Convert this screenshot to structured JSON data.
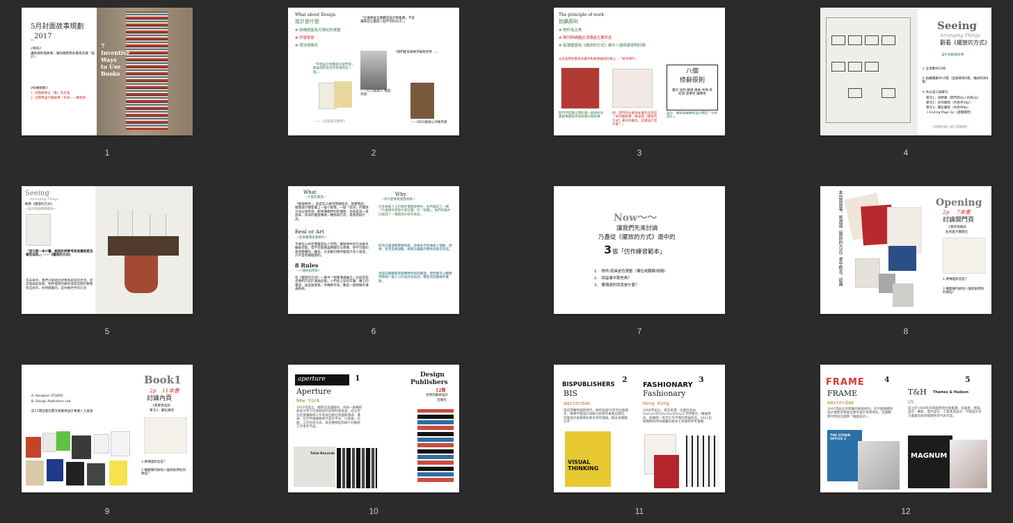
{
  "slides": [
    {
      "number": "1",
      "title": "5月封面故事規劃",
      "subtitle": "_2017",
      "goal_head": "//目的//",
      "goal": "讓組員對面故事，讓你願資預多書來認識「設計」",
      "idea_head": "//好構挑繁//",
      "idea1": "1. 封面故事以「書」為主角",
      "idea2": "2. 主題用設計面故事「形式」一觀相承",
      "cover_text": "7 Inventive Ways to Use Books"
    },
    {
      "number": "2",
      "heading": "What about Design",
      "title": "設計是什麼",
      "tag1": "# 將構想變為可視化的現實",
      "tag2": "# 符號學家",
      "tag3": "# 想法視覺化",
      "para1": "「企業將會全面體成設計師集團，不是讓來認之變成一個平均的日子。」",
      "para2": "「我們經常被要求擁有更早的溝通的方式，以當」",
      "quote1": "「平面設計師都是符號學家，無論他們是否有意識到這一點。」",
      "quote2": "「我們經常被要求擁抱世界…」",
      "cap1": "——《這就是符號學》",
      "cap2": "——CCC創辦人 增田宗昭",
      "cap3": "——IDEO創辦公司擁有者"
    },
    {
      "number": "3",
      "heading": "The principle of work",
      "title": "拍攝原則",
      "rule1": "# 物件為主角",
      "rule2": "# 陳列與構圖必須傳遞主要訊息",
      "rule3": "# 每張圖使用《擺放的方式》書中八個修辭原則討論",
      "note": "★這些原則都是本書針對故事編排的重心…「製作導引」",
      "box_title1": "八個",
      "box_title2": "修辭原則",
      "box_body": "層次 排列 觀感 陽傘 共鳴 終結感 當事性 讓賞性",
      "cap1": "開門詞是獨立間此書一般很好封面故事最後述說本書的開始事",
      "cap2": "例：開門詞主要演本書的訊息是「本封面故事，將透過《擺放的方式》書中的概念，認識設計是什麼？」",
      "cap3": "設計、攝影與編輯和設計都是「分析設計」。"
    },
    {
      "number": "4",
      "title": "Seeing",
      "subtitle": "Arranging Things",
      "zh_title": "觀看《擺放的方式》",
      "section": "設計修辭練習簿",
      "p1": "① 全頁數共20頁",
      "p2": "② 拍攝圖數共10張（直幅單頁6張，橫式跨頁8張）",
      "p3": "③ 共分成三個單元",
      "unit1": "單元1：說明書（開門詞2p+內頁2p）",
      "unit2": "單元2：仿作練習（內頁共16p）",
      "unit3": "單元3：變化練習（內頁共9p）",
      "unit4": "＋Ending Page 1p（處理練習）",
      "footer": "~說明內容八較八較較較~"
    },
    {
      "number": "5",
      "title": "Seeing",
      "subtitle": "Arranging Things",
      "section": "觀看《擺放的方式》",
      "section_sub": "~設計修辭練習樣本~",
      "quote": "「這只是一本小書，給設計師參考其他擺放是怎樣完成的。」——《擺放的方式》",
      "para": "在未來中，我們只能踏出想像和創造的步伐，從這個角度來看，物件擺放的解析過或是關於觀看有自身的，你所擺趣的，是你看世界的方式"
    },
    {
      "number": "6",
      "what": "What",
      "what_sub": "~什麼是擺放~",
      "why": "Why",
      "why_sub": "~為什麼要看擺放修辭~",
      "para1": "「擺放物件」，就是在三維空間裡組合、放置物品，擺放設計都是擺上一個小角落。一個「成功」的擺放方式必須有效、能夠傳遞特別的擺放，也就是說一再品味…有效的擺放傳達一種修辭行為，或者修辭行為。",
      "real": "Real or Art",
      "real_sub": "~是真實還是藝術的~",
      "para2": "不要在公共空間還是私人空間，擺放物件的行為幾乎擴展可能。但不可能簡直將都可以想像、更不可能的看到整體的，雖在、大多數的物件擺放只有人留意，只不是有關擺放的。",
      "rules": "8 Rules",
      "rules_sub": "~八個修辭原則~",
      "para3": "在《擺放的方式》一書中「視覺溝通概念」也就是說出我們只在於溝通這個，人們身上穿的衣服、購上的電話、桌型展者家。手機飾作等，都是一套明確的溝通系統。",
      "para4": "許多專業人士仍都從擺擺放物件，他們擺成了一種「什麼物件該放什麼位置」的「感覺」。他們的腦中已經成了一種無須分析的本能。",
      "para5": "所有的溝通都需要修辭。如果你不能傳達人理解、感受、甚至是被說服，那無法讓最的物件就無法完成。",
      "para6": "透過前面觀看來解構物件如何擺放，我們將可以觀察到每個一個小小的設計從說說，都是完成藝術的擺放。"
    },
    {
      "number": "7",
      "now": "Now～～",
      "line1": "讓我們先來討論",
      "line2": "乃嘉從《擺放的方式》選中的",
      "big3": "3",
      "line3": "張「仿作練習範本」",
      "q1": "1.　物件/道具是否更動（標位或翻轉/部隔）",
      "q2": "2.　保留書中那些角？",
      "q3": "3.　要傳遞的訊息是什麼？"
    },
    {
      "number": "8",
      "title": "Opening",
      "count": "2p",
      "count2": "7本書",
      "subtitle": "討論開門頁",
      "desc1": "1張跨頁橫式",
      "desc2": "右頁直大圖擺位",
      "vertical": "本封面故事，將透過《擺放的方式》書中概念，認識",
      "q1": "1.要傳遞訊息是？",
      "q2": "2.構圖陳列依照八個修辭原則的哪些？"
    },
    {
      "number": "9",
      "title": "Book1",
      "count": "2p",
      "count2": "11本書",
      "subtitle": "討論內頁",
      "desc1": "1張單頁直式",
      "desc2": "單元3：變化練習",
      "opt1": "A.  Designer STUDIO",
      "opt2": "B.  Design Publishers Lab",
      "line": "這11間出版社都深受藝術設計專業人士喜愛",
      "q1": "1.要傳遞訊息是？",
      "q2": "2.構圖陳列依照八個修辭原則的哪些？"
    },
    {
      "number": "10",
      "brand": "aperture",
      "idx": "1",
      "name": "Aperture",
      "city": "New York",
      "para": "1952年成立，總部在美國紐約，係由一群攝影家與文學工作者組成的非營利基金會，成立宗旨是要讓藝術工作者與出版社跨國藝溝通、溝通、在世界推廣藝術作品的平台，以策展、出版、工作坊等方式，來各種類型和媒介的藝術工作者友作品。",
      "book_title": "Total Records",
      "right_title1": "Design",
      "right_title2": "Publishers",
      "right_count": "12間",
      "right_desc1": "世界的藝術設計",
      "right_desc2": "出版社"
    },
    {
      "number": "11",
      "brand1": "BISPUBLISHERS",
      "idx1": "2",
      "name1": "BIS",
      "city1": "Amsterdam",
      "para1": "來自荷蘭阿姆斯特丹，擁有超過50年的出版歷史，專事平面設計與藝文創意的專業出版社，出版品內容著重創意思考的理論，概念與書籍分享",
      "book1": "VISUAL THINKING",
      "brand2": "FASHIONARY",
      "idx2": "3",
      "name2": "Fashionary",
      "city2": "Hong Kong",
      "para2": "2008年創立，來自香港，出版社名由Fashion/Dictionary/Diary三字所組合，擴展時尚、紡織等一系列工作手冊的周邊商品，2021出版服飾的時尚繪畫的紙本工具書和參考書籍"
    },
    {
      "number": "12",
      "brand1": "FRAME",
      "idx1": "4",
      "name1": "FRAME",
      "city1": "Amsterdam",
      "para1": "1997年創立的荷蘭阿姆斯特丹，在平面媒體的設計趨勢及專業出版中居於領導地位，出版觀察刊物並在國際「推廣設計」。",
      "book1": "THE OTHER OFFICE 2",
      "name2": "T&H",
      "brand2": "Thames & Hudson",
      "idx2": "5",
      "city2": "US",
      "para2": "成立於1949年的英國老牌出版集團，在藝術、建築、設計、攝影、室內設計、工業產品設計、平面設計等方面最出版領域都各有代表作品。",
      "book2": "MAGNUM"
    }
  ],
  "colors": {
    "background": "#2b2b2b",
    "green": "#3b7a4f",
    "red": "#c8342a",
    "slide": "#ffffff"
  }
}
